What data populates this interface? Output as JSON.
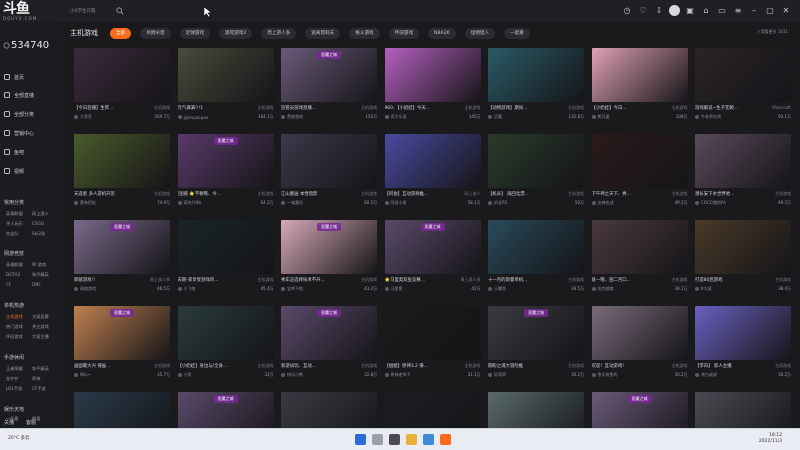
{
  "app": {
    "logo_text": "斗鱼",
    "logo_sub": "DOUYU.COM",
    "search_placeholder": "小6学生只帮"
  },
  "sidebar": {
    "count": "534740",
    "nav": [
      {
        "label": "首页",
        "icon": "home-icon"
      },
      {
        "label": "全部直播",
        "icon": "grid-icon"
      },
      {
        "label": "全部分类",
        "icon": "category-icon"
      },
      {
        "label": "营销中心",
        "icon": "shop-icon"
      },
      {
        "label": "鱼吧",
        "icon": "fish-icon"
      },
      {
        "label": "视频",
        "icon": "video-icon"
      }
    ],
    "groups": [
      {
        "title": "常用分类",
        "items": [
          "英雄联盟",
          "网上游人",
          "寻人玩乐",
          "CSGO",
          "交友队",
          "Ski2选"
        ]
      },
      {
        "title": "网游竞技",
        "items": [
          "英雄联盟",
          "W 游戏",
          "DOTA2",
          "和平精英",
          "CF",
          "DNF"
        ]
      },
      {
        "title": "单机热游",
        "items": [
          "主机游戏",
          "文娱竞赛",
          "热门游戏",
          "关注游戏",
          "怀旧游戏",
          "大宿主播"
        ]
      },
      {
        "title": "手游休闲",
        "items": [
          "王者荣耀",
          "和平精英",
          "金铲铲",
          "原神",
          "LOL手游",
          "CF手游"
        ]
      },
      {
        "title": "娱乐天地",
        "items": [
          "一起看",
          "颜值"
        ]
      }
    ],
    "bottom": [
      "关播",
      "客服"
    ]
  },
  "category": {
    "title": "主机游戏",
    "tabs": [
      "全部",
      "杀戮尖塔",
      "足球游戏",
      "黑死游戏2",
      "周上游人多",
      "逃离塔科夫",
      "格斗游戏",
      "怀旧游戏",
      "NBA2K",
      "怪物猎人",
      "一起看"
    ],
    "active_index": 0,
    "right_text": "上滑看更多 1611"
  },
  "cards": [
    {
      "title": "【今日首播】生死...",
      "tag": "主机游戏",
      "streamer": "大发狂",
      "hot": "269.7万",
      "badge": "",
      "bg": "#3a2a3a"
    },
    {
      "title": "元气满满!!!1",
      "tag": "主机游戏",
      "streamer": "pjzmpaopao",
      "hot": "164.1万",
      "badge": "",
      "bg": "#4a4a3c"
    },
    {
      "title": "监管员游戏直播...",
      "tag": "主机游戏",
      "streamer": "黑夜游戏",
      "hot": "150万",
      "badge": "恶魔之城",
      "bg": "#6a5a7a"
    },
    {
      "title": "960、【小奶娃】今天...",
      "tag": "主机游戏",
      "streamer": "奇才乐语",
      "hot": "145万",
      "badge": "",
      "bg": "#b560c0"
    },
    {
      "title": "【动物游戏】期间...",
      "tag": "主机游戏",
      "streamer": "沉寞",
      "hot": "132.8万",
      "badge": "",
      "bg": "#2a5a66"
    },
    {
      "title": "【小奶娃】今日...",
      "tag": "主机游戏",
      "streamer": "熊可爱",
      "hot": "108万",
      "badge": "",
      "bg": "#e0a0b4"
    },
    {
      "title": "游戏解说~生子无赖...",
      "tag": "Minecraft",
      "streamer": "牛老师在线",
      "hot": "93.1万",
      "badge": "",
      "bg": "#2a2428"
    },
    {
      "title": "天选者 多人游机开荒",
      "tag": "主机游戏",
      "streamer": "黄有招娃",
      "hot": "74.9万",
      "badge": "",
      "bg": "#4a5a2a"
    },
    {
      "title": "[困惑 ⭐不要哦、今...",
      "tag": "主机游戏",
      "streamer": "家的只Nb",
      "hot": "64.2万",
      "badge": "恶魔之城",
      "bg": "#5a3a6a"
    },
    {
      "title": "江山墨画 本性暗影",
      "tag": "主机游戏",
      "streamer": "一笔墨风",
      "hot": "60.5万",
      "badge": "",
      "bg": "#3a3a4a"
    },
    {
      "title": "【阿伯】互动游戏推...",
      "tag": "网上游人",
      "streamer": "阿伯小哥",
      "hot": "58.1万",
      "badge": "",
      "bg": "#4a4aa0"
    },
    {
      "title": "【机长】 再回北漂...",
      "tag": "主机游戏",
      "streamer": "机长RS",
      "hot": "50万",
      "badge": "",
      "bg": "#2a3a2a"
    },
    {
      "title": "下午神之天下、秀...",
      "tag": "主机游戏",
      "streamer": "出神也战",
      "hot": "49.2万",
      "badge": "",
      "bg": "#2a1a1a"
    },
    {
      "title": "潜长安下水世界地...",
      "tag": "主机游戏",
      "streamer": "COCO我的FA",
      "hot": "49.2万",
      "badge": "",
      "bg": "#5a4a5a"
    },
    {
      "title": "新献游戏!!",
      "tag": "网上游人多",
      "streamer": "网络游戏",
      "hot": "46.5万",
      "badge": "恶魔之城",
      "bg": "#7a6a8a"
    },
    {
      "title": "去期-来享受游戏的...",
      "tag": "主机游戏",
      "streamer": "小飞侠",
      "hot": "45.4万",
      "badge": "",
      "bg": "#1a2428"
    },
    {
      "title": "秀车应选择技术不开...",
      "tag": "主机游戏",
      "streamer": "宝鸡下航",
      "hot": "43.2万",
      "badge": "恶魔之城",
      "bg": "#d8a8b8"
    },
    {
      "title": "⭐马里奥双鱼竞赛...",
      "tag": "周上游人多",
      "streamer": "马里奥",
      "hot": "42万",
      "badge": "恶魔之城",
      "bg": "#5a4a6a"
    },
    {
      "title": "十一月的斯曼单机...",
      "tag": "主机游戏",
      "streamer": "小霖哥",
      "hot": "39.5万",
      "badge": "",
      "bg": "#2a4a5a"
    },
    {
      "title": "就一哦、困二月口...",
      "tag": "主机游戏",
      "streamer": "坦克娘娘",
      "hot": "39.1万",
      "badge": "",
      "bg": "#4a3a40"
    },
    {
      "title": "打造80后游戏",
      "tag": "主机游戏",
      "streamer": "K大叔",
      "hot": "38.4万",
      "badge": "",
      "bg": "#4a3a2a"
    },
    {
      "title": "画面暖大兴 帰画...",
      "tag": "主机游戏",
      "streamer": "啊lu~",
      "hot": "35.7万",
      "badge": "恶魔之城",
      "bg": "#c08050"
    },
    {
      "title": "【小奶娃】身边与/全身...",
      "tag": "主机游戏",
      "streamer": "小伊",
      "hot": "33万",
      "badge": "",
      "bg": "#2a3a3a"
    },
    {
      "title": "新游试玩、互动...",
      "tag": "主机游戏",
      "streamer": "快乐小鸭",
      "hot": "32.8万",
      "badge": "恶魔之城",
      "bg": "#5a4a6a"
    },
    {
      "title": "【姐姐】原神3.2 帰...",
      "tag": "主机游戏",
      "streamer": "原神老爷子",
      "hot": "31.1万",
      "badge": "",
      "bg": "#1a1a1a"
    },
    {
      "title": "期盼之魂大冒险推",
      "tag": "主机游戏",
      "streamer": "好哥哥",
      "hot": "30.2万",
      "badge": "恶魔之城",
      "bg": "#3a3a40"
    },
    {
      "title": "欢迎！互动游戏!",
      "tag": "主机游戏",
      "streamer": "鱼乐有鱼的",
      "hot": "30.2万",
      "badge": "",
      "bg": "#7a6a7a"
    },
    {
      "title": "【李白】 新人主播",
      "tag": "主机游戏",
      "streamer": "李白叔叔",
      "hot": "30.2万",
      "badge": "",
      "bg": "#6a60c0"
    },
    {
      "title": "",
      "tag": "",
      "streamer": "",
      "hot": "",
      "badge": "",
      "bg": "#2a3a4a"
    },
    {
      "title": "",
      "tag": "",
      "streamer": "",
      "hot": "",
      "badge": "恶魔之城",
      "bg": "#5a4a6a"
    },
    {
      "title": "",
      "tag": "",
      "streamer": "",
      "hot": "",
      "badge": "",
      "bg": "#3a3a42"
    },
    {
      "title": "",
      "tag": "",
      "streamer": "",
      "hot": "",
      "badge": "",
      "bg": "#1e1e22"
    },
    {
      "title": "",
      "tag": "",
      "streamer": "",
      "hot": "",
      "badge": "",
      "bg": "#5a6a6a"
    },
    {
      "title": "",
      "tag": "",
      "streamer": "",
      "hot": "",
      "badge": "恶魔之城",
      "bg": "#6a5a7a"
    },
    {
      "title": "",
      "tag": "",
      "streamer": "",
      "hot": "",
      "badge": "",
      "bg": "#4a4a52"
    }
  ],
  "taskbar": {
    "time": "18:12",
    "date": "2022/11/3",
    "weather": "20°C 多云"
  },
  "colors": {
    "accent": "#ff6a1a",
    "bg": "#1a1a1d",
    "sidebar_bg": "#1c1c20"
  }
}
